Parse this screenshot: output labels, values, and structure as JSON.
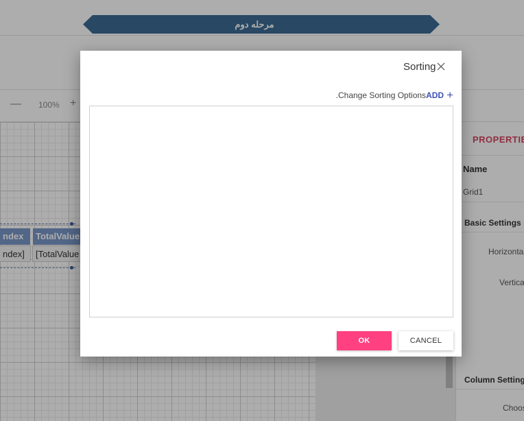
{
  "stage": {
    "label": "مرحله دوم",
    "color": "#3b6a93"
  },
  "toolbar": {
    "zoom_out_symbol": "—",
    "zoom_level": "100%",
    "zoom_in_symbol": "+"
  },
  "grid_widget": {
    "headers": [
      "ndex",
      "TotalValue"
    ],
    "cells": [
      "ndex]",
      "[TotalValue"
    ]
  },
  "properties": {
    "title": "PROPERTIE",
    "name_label": "Name",
    "name_value": "Grid1",
    "basic_settings": "Basic Settings",
    "horizontal": "Horizonta",
    "vertical": "Vertica",
    "column_settings": "Column Setting",
    "choose": "Choos"
  },
  "dialog": {
    "title": "Sorting",
    "close_icon": "close-icon",
    "instructions": ".Change Sorting Options",
    "add_label": "ADD",
    "add_icon": "+",
    "ok_label": "OK",
    "cancel_label": "CANCEL",
    "ok_color": "#ff4081",
    "add_color": "#3f51b5"
  }
}
